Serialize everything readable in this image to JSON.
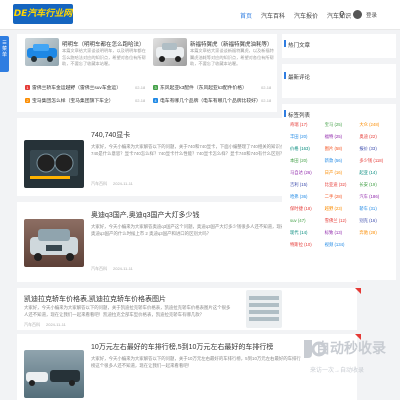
{
  "header": {
    "logo_text": "DE汽车行业网站",
    "nav": [
      "首页",
      "汽车百科",
      "汽车报价",
      "汽车知识"
    ],
    "active_index": 0,
    "login_label": "登录"
  },
  "side_tab_label": "菜单",
  "featured": [
    {
      "title": "明明车（明明车都在怎么跑哈法）",
      "desc": "本篇文章给大家谈谈明明车，以及明明车都在怎么跑哈法对应的知识点，希望对各位有所帮助，不要忘了收藏本站喔。"
    },
    {
      "title": "新福特翼虎（新福特翼虎油耗等）",
      "desc": "本篇文章给大家谈谈新福特翼虎，以及新福特翼虎油耗等对应的知识点，希望对各位有所帮助，不要忘了收藏本站喔。"
    }
  ],
  "links": [
    {
      "num": "1",
      "color": "#e53935",
      "text": "雷佛兰轿车金运越野（雷佛兰suv车金运）",
      "date": "02-18"
    },
    {
      "num": "2",
      "color": "#fb8c00",
      "text": "宝马集团怎么样（宝马集团旗下车企）",
      "date": "02-18"
    },
    {
      "num": "3",
      "color": "#43a047",
      "text": "东风起亚k3配件（东风起亚k3配件价格）",
      "date": "02-18"
    },
    {
      "num": "4",
      "color": "#1e88e5",
      "text": "电车有哪几个品牌（电车有哪几个品牌比较好）",
      "date": "02-18"
    }
  ],
  "posts": [
    {
      "title": "740,740显卡",
      "excerpt": "大家好，今天小编来为大家解答以下的问题，关于740和740显卡，下面小编整理了740相关的知识点，让我们一起看看吧。740是什么意思？显卡740怎么样？740显卡什么性能？740显卡怎么样？显卡740和740有什么区别？740显卡能玩什么游戏？",
      "category": "汽车百科",
      "date": "2024-11-11"
    },
    {
      "title": "奥迪q3国产,奥迪q3国产大灯多少钱",
      "excerpt": "大家好，今天小编来为大家解答奥迪q3国产这个问题，奥迪q3国产大灯多少钱很多人还不知道，现在让我们一起来看看吧！1 奥迪q3国产的什么时候上市 2 奥迪q3国产和进口的区别大吗？",
      "category": "汽车百科",
      "date": "2024-11-11"
    },
    {
      "title": "凯迪拉克轿车价格表,凯迪拉克轿车价格表图片",
      "excerpt": "大家好，今天小编来为大家解答以下的问题，关于凯迪拉克轿车价格表，凯迪拉克轿车价格表图片这个很多人还不知道，现在让我们一起来看看吧！凯迪拉克全部车型价格表，凯迪拉克轿车有哪几款？",
      "category": "汽车百科",
      "date": "2024-11-11"
    },
    {
      "title": "10万元左右最好的车排行榜,5到10万元左右最好的车排行榜",
      "excerpt": "大家好，今天小编来为大家解答以下的问题，关于10万元左右最好的车排行榜，5到10万元左右最好的车排行榜这个很多人还不知道，现在让我们一起来看看吧！",
      "category": "汽车百科",
      "date": "2024-11-11"
    }
  ],
  "sidebar": {
    "widgets": [
      "热门文章",
      "最新评论",
      "标签列表"
    ],
    "tags": [
      {
        "label": "奇瑞 (17)",
        "color": "#e53935"
      },
      {
        "label": "宝马 (25)",
        "color": "#43a047"
      },
      {
        "label": "大众 (248)",
        "color": "#fb8c00"
      },
      {
        "label": "丰田 (20)",
        "color": "#1e88e5"
      },
      {
        "label": "福特 (25)",
        "color": "#8e24aa"
      },
      {
        "label": "奥迪 (22)",
        "color": "#e53935"
      },
      {
        "label": "价格 (163)",
        "color": "#00897b"
      },
      {
        "label": "图片 (58)",
        "color": "#f4511e"
      },
      {
        "label": "报价 (33)",
        "color": "#3949ab"
      },
      {
        "label": "本田 (20)",
        "color": "#43a047"
      },
      {
        "label": "新款 (56)",
        "color": "#1e88e5"
      },
      {
        "label": "多少钱 (118)",
        "color": "#e53935"
      },
      {
        "label": "马自达 (26)",
        "color": "#8e24aa"
      },
      {
        "label": "日产 (16)",
        "color": "#fb8c00"
      },
      {
        "label": "起亚 (14)",
        "color": "#00897b"
      },
      {
        "label": "吉利 (15)",
        "color": "#3949ab"
      },
      {
        "label": "比亚迪 (32)",
        "color": "#e53935"
      },
      {
        "label": "长安 (19)",
        "color": "#43a047"
      },
      {
        "label": "哈弗 (36)",
        "color": "#1e88e5"
      },
      {
        "label": "二手 (28)",
        "color": "#f4511e"
      },
      {
        "label": "汽车 (186)",
        "color": "#8e24aa"
      },
      {
        "label": "保时捷 (18)",
        "color": "#e53935"
      },
      {
        "label": "越野 (23)",
        "color": "#fb8c00"
      },
      {
        "label": "轿车 (31)",
        "color": "#1e88e5"
      },
      {
        "label": "suv (47)",
        "color": "#43a047"
      },
      {
        "label": "雪佛兰 (12)",
        "color": "#e53935"
      },
      {
        "label": "别克 (16)",
        "color": "#3949ab"
      },
      {
        "label": "现代 (14)",
        "color": "#00897b"
      },
      {
        "label": "标致 (13)",
        "color": "#8e24aa"
      },
      {
        "label": "奔驰 (28)",
        "color": "#fb8c00"
      },
      {
        "label": "特斯拉 (10)",
        "color": "#e53935"
      },
      {
        "label": "视频 (134)",
        "color": "#1e88e5"
      }
    ]
  },
  "watermark": {
    "text": "自动秒收录",
    "sub": "来访一次→自动收录"
  }
}
